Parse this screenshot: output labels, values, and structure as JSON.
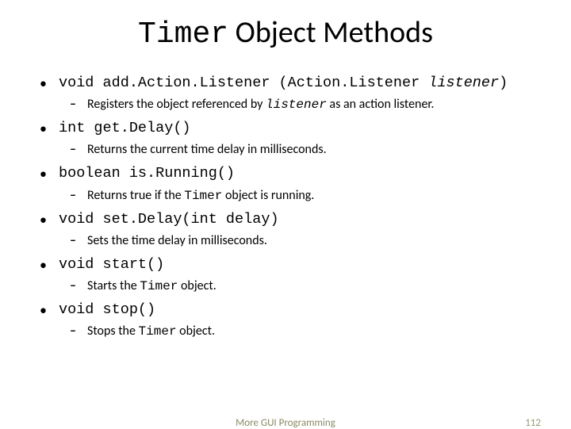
{
  "title": {
    "left": "Timer",
    "right": " Object Methods"
  },
  "items": [
    {
      "sig_pre": "void add.Action.Listener (Action.Listener ",
      "sig_it": "listener",
      "sig_post": ")",
      "desc_pre": "Registers the object referenced by ",
      "desc_code": "listener",
      "desc_post": " as an action listener."
    },
    {
      "sig_pre": "int get.Delay()",
      "sig_it": "",
      "sig_post": "",
      "desc_pre": "Returns the current time delay in milliseconds.",
      "desc_code": "",
      "desc_post": ""
    },
    {
      "sig_pre": "boolean is.Running()",
      "sig_it": "",
      "sig_post": "",
      "desc_pre": "Returns true if the ",
      "desc_code": "Timer",
      "desc_post": " object is running."
    },
    {
      "sig_pre": "void set.Delay(int delay)",
      "sig_it": "",
      "sig_post": "",
      "desc_pre": "Sets the time delay in milliseconds.",
      "desc_code": "",
      "desc_post": ""
    },
    {
      "sig_pre": "void start()",
      "sig_it": "",
      "sig_post": "",
      "desc_pre": "Starts the ",
      "desc_code": "Timer",
      "desc_post": " object."
    },
    {
      "sig_pre": "void stop()",
      "sig_it": "",
      "sig_post": "",
      "desc_pre": "Stops the ",
      "desc_code": "Timer",
      "desc_post": " object."
    }
  ],
  "footer": {
    "center": "More GUI Programming",
    "page": "112"
  }
}
